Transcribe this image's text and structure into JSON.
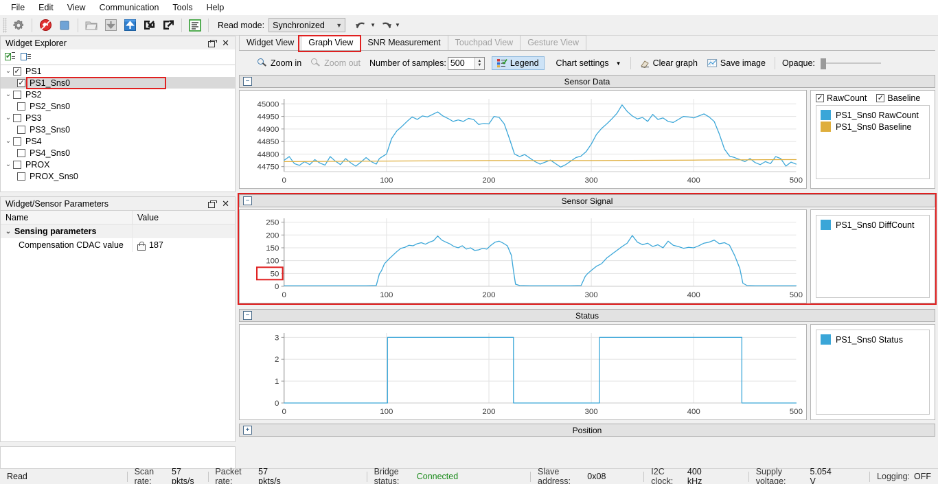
{
  "menu": {
    "items": [
      "File",
      "Edit",
      "View",
      "Communication",
      "Tools",
      "Help"
    ]
  },
  "toolbar": {
    "icons": [
      "gear-icon",
      "disconnect-icon",
      "stop-icon",
      "open-file-icon",
      "download-icon",
      "upload-icon",
      "import-icon",
      "export-icon",
      "log-icon"
    ],
    "read_mode_label": "Read mode:",
    "read_mode_value": "Synchronized",
    "undo_label": "undo",
    "redo_label": "redo"
  },
  "left_dock": {
    "widget_explorer": {
      "title": "Widget Explorer",
      "nodes": [
        {
          "label": "PS1",
          "checked": true,
          "expanded": true,
          "child": {
            "label": "PS1_Sns0",
            "checked": true,
            "selected": true,
            "highlighted": true
          }
        },
        {
          "label": "PS2",
          "checked": false,
          "expanded": true,
          "child": {
            "label": "PS2_Sns0",
            "checked": false,
            "selected": false,
            "highlighted": false
          }
        },
        {
          "label": "PS3",
          "checked": false,
          "expanded": true,
          "child": {
            "label": "PS3_Sns0",
            "checked": false,
            "selected": false,
            "highlighted": false
          }
        },
        {
          "label": "PS4",
          "checked": false,
          "expanded": true,
          "child": {
            "label": "PS4_Sns0",
            "checked": false,
            "selected": false,
            "highlighted": false
          }
        },
        {
          "label": "PROX",
          "checked": false,
          "expanded": true,
          "child": {
            "label": "PROX_Sns0",
            "checked": false,
            "selected": false,
            "highlighted": false
          }
        }
      ]
    },
    "parameters": {
      "title": "Widget/Sensor Parameters",
      "col_name": "Name",
      "col_value": "Value",
      "group_label": "Sensing parameters",
      "rows": [
        {
          "name": "Compensation CDAC value",
          "value": "187",
          "locked": true
        }
      ]
    }
  },
  "tabs": [
    {
      "label": "Widget View",
      "active": false,
      "disabled": false,
      "highlighted": false
    },
    {
      "label": "Graph View",
      "active": true,
      "disabled": false,
      "highlighted": true
    },
    {
      "label": "SNR Measurement",
      "active": false,
      "disabled": false,
      "highlighted": false
    },
    {
      "label": "Touchpad View",
      "active": false,
      "disabled": true,
      "highlighted": false
    },
    {
      "label": "Gesture View",
      "active": false,
      "disabled": true,
      "highlighted": false
    }
  ],
  "chart_toolbar": {
    "zoom_in": "Zoom in",
    "zoom_out": "Zoom out",
    "samples_label": "Number of samples:",
    "samples_value": "500",
    "legend": "Legend",
    "chart_settings": "Chart settings",
    "clear_graph": "Clear graph",
    "save_image": "Save image",
    "opaque_label": "Opaque:"
  },
  "panels": {
    "sensor_data": {
      "title": "Sensor Data",
      "collapse_glyph": "−",
      "legend": {
        "toggles": [
          {
            "label": "RawCount",
            "checked": true
          },
          {
            "label": "Baseline",
            "checked": true
          }
        ],
        "series": [
          {
            "label": "PS1_Sns0 RawCount",
            "color": "#3aa6d8"
          },
          {
            "label": "PS1_Sns0 Baseline",
            "color": "#dfae3c"
          }
        ]
      }
    },
    "sensor_signal": {
      "title": "Sensor Signal",
      "collapse_glyph": "−",
      "highlighted": true,
      "legend": {
        "series": [
          {
            "label": "PS1_Sns0 DiffCount",
            "color": "#3aa6d8"
          }
        ]
      }
    },
    "status": {
      "title": "Status",
      "collapse_glyph": "−",
      "legend": {
        "series": [
          {
            "label": "PS1_Sns0 Status",
            "color": "#3aa6d8"
          }
        ]
      }
    },
    "position": {
      "title": "Position",
      "collapse_glyph": "+"
    }
  },
  "statusbar": {
    "read_state": "Read",
    "cells": [
      {
        "key": "Scan rate:",
        "value": "57 pkts/s",
        "ok": false
      },
      {
        "key": "Packet rate:",
        "value": "57 pkts/s",
        "ok": false
      },
      {
        "key": "Bridge status:",
        "value": "Connected",
        "ok": true
      },
      {
        "key": "Slave address:",
        "value": "0x08",
        "ok": false
      },
      {
        "key": "I2C clock:",
        "value": "400 kHz",
        "ok": false
      },
      {
        "key": "Supply voltage:",
        "value": "5.054 V",
        "ok": false
      },
      {
        "key": "Logging:",
        "value": "OFF",
        "ok": false
      }
    ]
  },
  "chart_data": [
    {
      "id": "sensor_data",
      "type": "line",
      "title": "Sensor Data",
      "xlabel": "",
      "ylabel": "",
      "xlim": [
        0,
        500
      ],
      "ylim": [
        44730,
        45020
      ],
      "xticks": [
        0,
        100,
        200,
        300,
        400,
        500
      ],
      "yticks": [
        44750,
        44800,
        44850,
        44900,
        44950,
        45000
      ],
      "grid": true,
      "legend_position": "right",
      "series": [
        {
          "name": "PS1_Sns0 RawCount",
          "color": "#3aa6d8",
          "x": [
            0,
            5,
            10,
            15,
            20,
            25,
            30,
            35,
            40,
            45,
            50,
            55,
            60,
            65,
            70,
            75,
            80,
            85,
            90,
            93,
            96,
            100,
            105,
            110,
            115,
            120,
            125,
            130,
            135,
            140,
            145,
            150,
            155,
            160,
            165,
            170,
            175,
            180,
            185,
            190,
            195,
            200,
            205,
            210,
            215,
            220,
            225,
            230,
            235,
            240,
            245,
            250,
            255,
            260,
            265,
            270,
            275,
            280,
            285,
            290,
            295,
            300,
            305,
            310,
            315,
            320,
            325,
            330,
            335,
            340,
            345,
            350,
            355,
            360,
            365,
            370,
            375,
            380,
            385,
            390,
            395,
            400,
            405,
            410,
            415,
            420,
            425,
            430,
            435,
            440,
            445,
            450,
            455,
            460,
            465,
            470,
            475,
            480,
            485,
            490,
            495,
            500
          ],
          "y": [
            44775,
            44790,
            44762,
            44755,
            44770,
            44758,
            44778,
            44764,
            44756,
            44790,
            44772,
            44758,
            44782,
            44765,
            44752,
            44768,
            44786,
            44770,
            44760,
            44782,
            44790,
            44800,
            44862,
            44892,
            44910,
            44930,
            44948,
            44938,
            44952,
            44948,
            44958,
            44968,
            44952,
            44942,
            44930,
            44936,
            44930,
            44942,
            44938,
            44918,
            44922,
            44920,
            44950,
            44946,
            44920,
            44862,
            44800,
            44790,
            44798,
            44784,
            44770,
            44760,
            44768,
            44776,
            44762,
            44748,
            44758,
            44772,
            44786,
            44792,
            44810,
            44840,
            44878,
            44902,
            44920,
            44940,
            44962,
            44996,
            44970,
            44952,
            44940,
            44946,
            44930,
            44958,
            44938,
            44944,
            44930,
            44926,
            44938,
            44950,
            44948,
            44944,
            44952,
            44960,
            44948,
            44930,
            44880,
            44820,
            44792,
            44786,
            44778,
            44770,
            44782,
            44766,
            44758,
            44770,
            44762,
            44790,
            44782,
            44752,
            44768,
            44760
          ]
        },
        {
          "name": "PS1_Sns0 Baseline",
          "color": "#dfae3c",
          "x": [
            0,
            100,
            200,
            300,
            400,
            500
          ],
          "y": [
            44770,
            44772,
            44774,
            44774,
            44776,
            44778
          ]
        }
      ]
    },
    {
      "id": "sensor_signal",
      "type": "line",
      "title": "Sensor Signal",
      "xlabel": "",
      "ylabel": "",
      "xlim": [
        0,
        500
      ],
      "ylim": [
        0,
        265
      ],
      "xticks": [
        0,
        100,
        200,
        300,
        400,
        500
      ],
      "yticks": [
        0,
        50,
        100,
        150,
        200,
        250
      ],
      "highlighted_ytick": 50,
      "grid": true,
      "legend_position": "right",
      "series": [
        {
          "name": "PS1_Sns0 DiffCount",
          "color": "#3aa6d8",
          "x": [
            0,
            10,
            20,
            30,
            40,
            50,
            60,
            70,
            80,
            90,
            93,
            95,
            98,
            102,
            106,
            110,
            114,
            118,
            122,
            126,
            130,
            134,
            138,
            142,
            146,
            150,
            154,
            158,
            162,
            166,
            170,
            174,
            178,
            182,
            186,
            190,
            194,
            198,
            202,
            206,
            210,
            214,
            218,
            222,
            224,
            226,
            230,
            240,
            250,
            260,
            270,
            280,
            290,
            294,
            296,
            300,
            305,
            310,
            315,
            320,
            325,
            330,
            335,
            340,
            345,
            350,
            355,
            360,
            365,
            370,
            375,
            380,
            385,
            390,
            395,
            400,
            405,
            410,
            415,
            420,
            425,
            430,
            435,
            440,
            445,
            448,
            452,
            460,
            470,
            480,
            490,
            500
          ],
          "y": [
            2,
            2,
            2,
            2,
            2,
            2,
            2,
            2,
            2,
            3,
            48,
            60,
            88,
            105,
            120,
            135,
            148,
            152,
            160,
            158,
            166,
            170,
            164,
            172,
            178,
            196,
            180,
            172,
            165,
            155,
            150,
            158,
            145,
            150,
            140,
            142,
            148,
            145,
            160,
            172,
            176,
            168,
            158,
            120,
            60,
            8,
            3,
            2,
            2,
            2,
            2,
            2,
            3,
            38,
            48,
            62,
            78,
            88,
            110,
            125,
            140,
            155,
            168,
            198,
            172,
            162,
            168,
            155,
            162,
            150,
            176,
            160,
            155,
            148,
            152,
            150,
            158,
            168,
            172,
            180,
            166,
            170,
            160,
            120,
            70,
            12,
            3,
            2,
            2,
            2,
            2,
            2
          ]
        }
      ]
    },
    {
      "id": "status",
      "type": "line",
      "title": "Status",
      "xlabel": "",
      "ylabel": "",
      "xlim": [
        0,
        500
      ],
      "ylim": [
        0,
        3.2
      ],
      "xticks": [
        0,
        100,
        200,
        300,
        400,
        500
      ],
      "yticks": [
        0,
        1,
        2,
        3
      ],
      "grid": true,
      "legend_position": "right",
      "series": [
        {
          "name": "PS1_Sns0 Status",
          "color": "#3aa6d8",
          "x": [
            0,
            101,
            101,
            224,
            224,
            308,
            308,
            447,
            447,
            500
          ],
          "y": [
            0,
            0,
            3,
            3,
            0,
            0,
            3,
            3,
            0,
            0
          ]
        }
      ]
    }
  ]
}
